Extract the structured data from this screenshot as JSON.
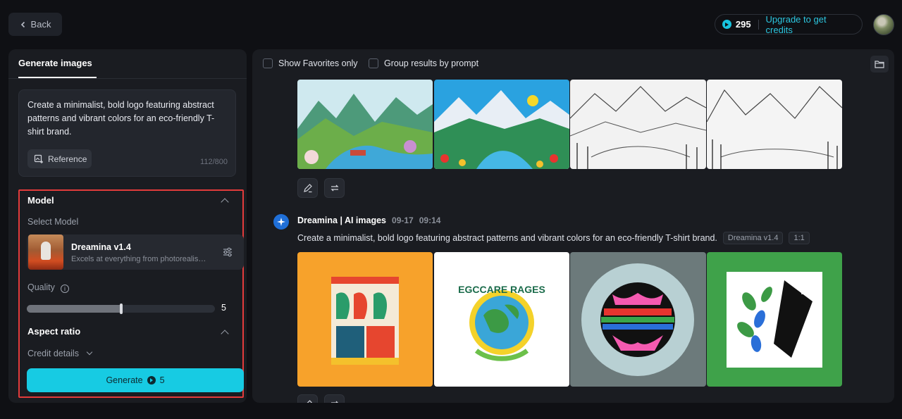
{
  "topbar": {
    "back_label": "Back",
    "credits_count": "295",
    "upgrade_label": "Upgrade to get credits"
  },
  "left_panel": {
    "tab_label": "Generate images",
    "prompt_text": "Create a minimalist, bold logo featuring abstract patterns and vibrant colors for an eco-friendly T-shirt brand.",
    "reference_label": "Reference",
    "char_count": "112/800",
    "model_section": {
      "title": "Model",
      "select_label": "Select Model",
      "model_name": "Dreamina v1.4",
      "model_desc": "Excels at everything from photorealism to painterly style",
      "quality_label": "Quality",
      "quality_value": "5",
      "quality_fraction": 0.5,
      "aspect_title": "Aspect ratio",
      "credit_details_label": "Credit details",
      "generate_label": "Generate",
      "generate_cost": "5"
    }
  },
  "right_panel": {
    "show_favorites_label": "Show Favorites only",
    "group_results_label": "Group results by prompt",
    "result": {
      "author": "Dreamina | AI images",
      "date": "09-17",
      "time": "09:14",
      "prompt": "Create a minimalist, bold logo featuring abstract patterns and vibrant colors for an eco-friendly T-shirt brand.",
      "model_tag": "Dreamina v1.4",
      "ratio_tag": "1:1",
      "logo_1_text": "EGCCARE RAGES"
    }
  },
  "colors": {
    "accent": "#17cbe3",
    "highlight_border": "#e23b3b",
    "panel_bg": "#1a1c21",
    "page_bg": "#0f1014"
  }
}
